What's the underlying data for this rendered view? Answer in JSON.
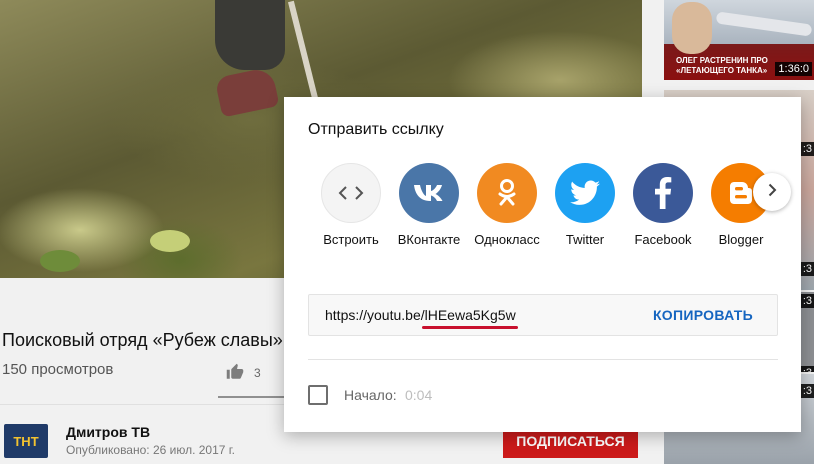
{
  "video": {
    "title": "Поисковый отряд «Рубеж славы»",
    "views": "150 просмотров",
    "likes": "3"
  },
  "channel": {
    "avatar_text": "ТНТ",
    "name": "Дмитров ТВ",
    "published": "Опубликовано: 26 июл. 2017 г.",
    "subscribe_label": "ПОДПИСАТЬСЯ"
  },
  "sidebar": {
    "items": [
      {
        "caption": "ОЛЕГ РАСТРЕНИН ПРО «ЛЕТАЮЩЕГО ТАНКА»",
        "duration": "1:36:0"
      },
      {
        "duration": ":3"
      },
      {
        "duration": ":3"
      },
      {
        "duration": ":3"
      },
      {
        "duration": ":3"
      },
      {
        "duration": ":3"
      }
    ]
  },
  "share_dialog": {
    "title": "Отправить ссылку",
    "services": [
      {
        "label": "Встроить",
        "icon": "embed-icon",
        "color": "#f1f1f1"
      },
      {
        "label": "ВКонтакте",
        "icon": "vk-icon",
        "color": "#4a76a8"
      },
      {
        "label": "Однокласс",
        "icon": "odnoklassniki-icon",
        "color": "#f18a21"
      },
      {
        "label": "Twitter",
        "icon": "twitter-icon",
        "color": "#1da1f2"
      },
      {
        "label": "Facebook",
        "icon": "facebook-icon",
        "color": "#3b5998"
      },
      {
        "label": "Blogger",
        "icon": "blogger-icon",
        "color": "#f57d00"
      }
    ],
    "next_icon": "chevron-right-icon",
    "url_prefix": "https://youtu.be/",
    "url_id": "lHEewa5Kg5w",
    "copy_label": "КОПИРОВАТЬ",
    "start_label": "Начало:",
    "start_time": "0:04",
    "start_checked": false
  },
  "colors": {
    "accent_blue": "#1565c0",
    "subscribe_red": "#cc1a1a",
    "underline_red": "#c8102e"
  }
}
